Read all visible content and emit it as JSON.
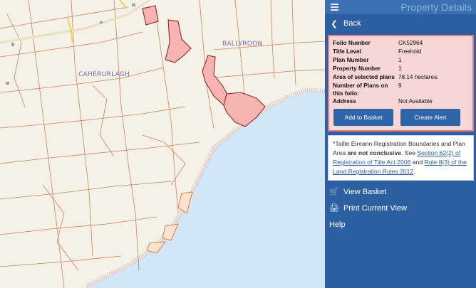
{
  "panel": {
    "title": "Property Details",
    "back_label": "Back"
  },
  "folio": {
    "rows": [
      {
        "key": "Folio Number",
        "value": "CK52964"
      },
      {
        "key": "Title Level",
        "value": "Freehold"
      },
      {
        "key": "Plan Number",
        "value": "1"
      },
      {
        "key": "Property Number",
        "value": "1"
      },
      {
        "key": "Area of selected plans",
        "value": "78.14 hectares."
      },
      {
        "key": "Number of Plans on this folio:",
        "value": "9"
      },
      {
        "key": "Address",
        "value": "Not Available"
      }
    ],
    "add_to_basket_label": "Add to Basket",
    "create_alert_label": "Create Alert"
  },
  "note": {
    "prefix": "*Tailte Éireann Registration Boundaries and Plan Area ",
    "bold": "are not conclusive",
    "middle": ". See ",
    "link1": "Section 62(2) of Registration of Title Act 2006",
    "and_text": " and ",
    "link2": "Rule 8(3) of the Land Registration Rules 2012",
    "suffix": "."
  },
  "nav": {
    "view_basket_label": "View Basket",
    "print_label": "Print Current View",
    "help_label": "Help"
  },
  "map": {
    "place_names": [
      "BALLYROON",
      "CAHERURLAGH"
    ]
  },
  "colors": {
    "panel_bg": "#2c60a3",
    "highlight_fill": "#f6b3b0",
    "highlight_stroke": "#7a2020",
    "sea": "#cfe7f7",
    "boundary": "#c96d4a"
  }
}
